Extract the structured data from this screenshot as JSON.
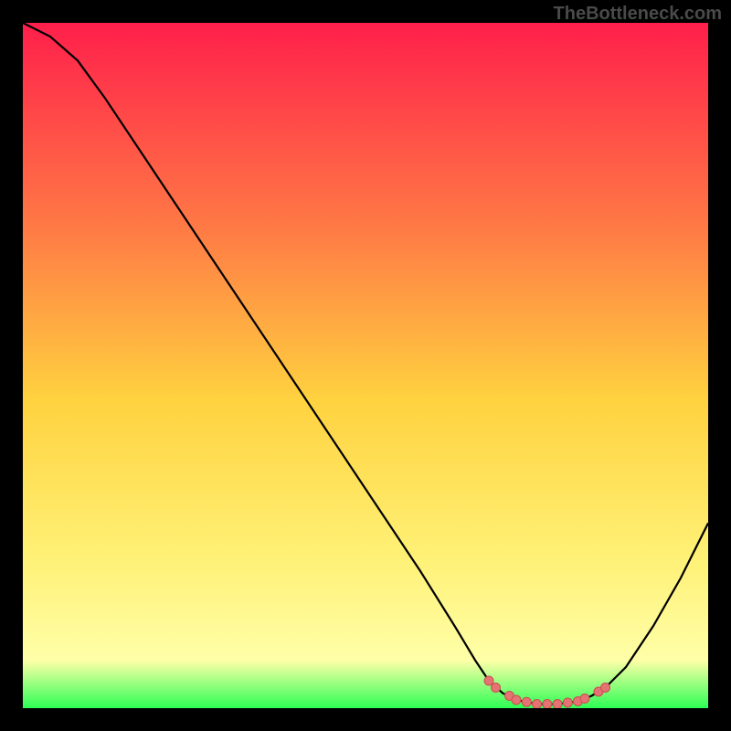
{
  "watermark": "TheBottleneck.com",
  "colors": {
    "frame": "#000000",
    "gradient_top": "#ff1f4b",
    "gradient_mid_upper": "#ff7a45",
    "gradient_mid": "#ffd23f",
    "gradient_mid_lower": "#fff176",
    "gradient_low": "#ffffa8",
    "gradient_bottom": "#2dff55",
    "curve": "#000000",
    "markers_fill": "#e57373",
    "markers_stroke": "#c94f4f"
  },
  "chart_data": {
    "type": "line",
    "title": "",
    "xlabel": "",
    "ylabel": "",
    "xlim": [
      0,
      100
    ],
    "ylim": [
      0,
      100
    ],
    "curve": [
      {
        "x": 0,
        "y": 100
      },
      {
        "x": 4,
        "y": 98
      },
      {
        "x": 8,
        "y": 94.5
      },
      {
        "x": 12,
        "y": 89
      },
      {
        "x": 20,
        "y": 77
      },
      {
        "x": 30,
        "y": 62
      },
      {
        "x": 40,
        "y": 47
      },
      {
        "x": 50,
        "y": 32
      },
      {
        "x": 58,
        "y": 20
      },
      {
        "x": 63,
        "y": 12
      },
      {
        "x": 66,
        "y": 7
      },
      {
        "x": 68,
        "y": 4
      },
      {
        "x": 70,
        "y": 2.2
      },
      {
        "x": 72,
        "y": 1.2
      },
      {
        "x": 75,
        "y": 0.6
      },
      {
        "x": 78,
        "y": 0.6
      },
      {
        "x": 81,
        "y": 1.0
      },
      {
        "x": 83,
        "y": 1.8
      },
      {
        "x": 85,
        "y": 3.0
      },
      {
        "x": 88,
        "y": 6.0
      },
      {
        "x": 92,
        "y": 12.0
      },
      {
        "x": 96,
        "y": 19.0
      },
      {
        "x": 100,
        "y": 27.0
      }
    ],
    "markers": [
      {
        "x": 68,
        "y": 4.0
      },
      {
        "x": 69,
        "y": 3.0
      },
      {
        "x": 71,
        "y": 1.8
      },
      {
        "x": 72,
        "y": 1.2
      },
      {
        "x": 73.5,
        "y": 0.9
      },
      {
        "x": 75,
        "y": 0.6
      },
      {
        "x": 76.5,
        "y": 0.6
      },
      {
        "x": 78,
        "y": 0.6
      },
      {
        "x": 79.5,
        "y": 0.8
      },
      {
        "x": 81,
        "y": 1.0
      },
      {
        "x": 82,
        "y": 1.4
      },
      {
        "x": 84,
        "y": 2.4
      },
      {
        "x": 85,
        "y": 3.0
      }
    ]
  }
}
